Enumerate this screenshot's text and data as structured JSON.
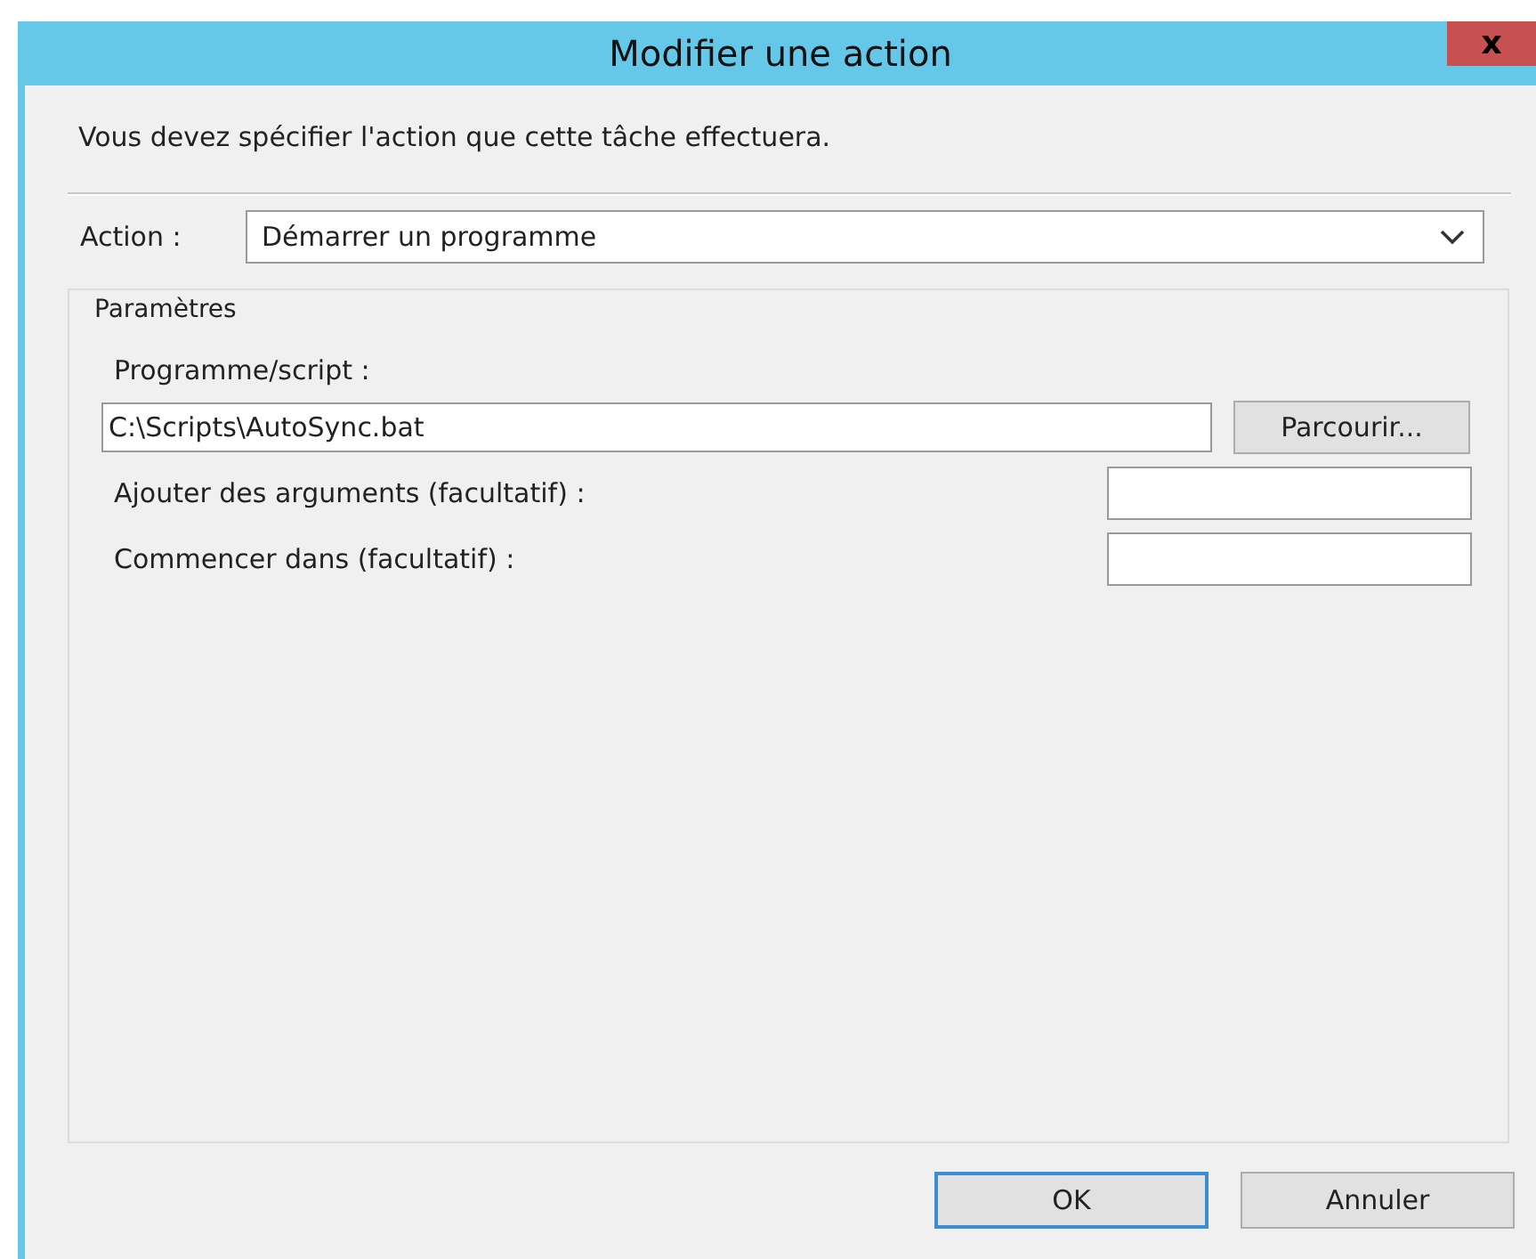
{
  "window": {
    "title": "Modifier une action",
    "close": "x"
  },
  "instruction": "Vous devez spécifier l'action que cette tâche effectuera.",
  "action": {
    "label": "Action :",
    "value": "Démarrer un programme"
  },
  "settings": {
    "legend": "Paramètres",
    "program": {
      "label": "Programme/script :",
      "value": "C:\\Scripts\\AutoSync.bat",
      "browse": "Parcourir..."
    },
    "fields": [
      {
        "label": "Ajouter des arguments (facultatif) :"
      },
      {
        "label": "Commencer dans (facultatif) :"
      }
    ]
  },
  "buttons": [
    {
      "label": "OK",
      "default": true
    },
    {
      "label": "Annuler",
      "default": false
    }
  ]
}
